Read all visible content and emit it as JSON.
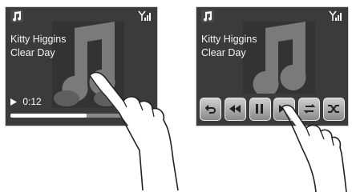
{
  "screens": {
    "left": {
      "track": {
        "artist": "Kitty Higgins",
        "title": "Clear Day"
      },
      "playback": {
        "state_icon": "play-icon",
        "time": "0:12",
        "progress": 0.55
      }
    },
    "right": {
      "track": {
        "artist": "Kitty Higgins",
        "title": "Clear Day"
      },
      "controls": [
        {
          "icon": "repeat-back-icon"
        },
        {
          "icon": "rewind-icon"
        },
        {
          "icon": "pause-icon"
        },
        {
          "icon": "skip-forward-icon"
        },
        {
          "icon": "repeat-icon"
        },
        {
          "icon": "shuffle-icon"
        }
      ]
    }
  },
  "colors": {
    "screen_bg": "#3b3b3b",
    "text": "#ffffff",
    "art": "#7a7a7a",
    "button": "#b5b5b5"
  }
}
